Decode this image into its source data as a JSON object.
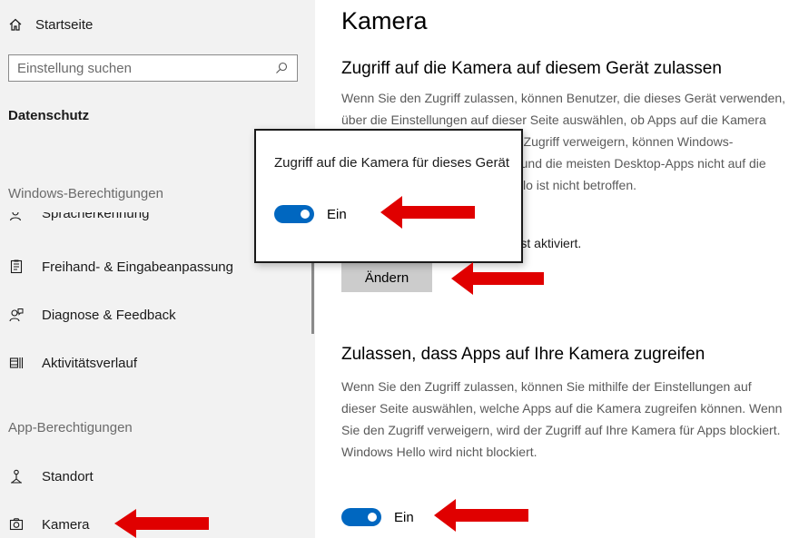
{
  "sidebar": {
    "home_label": "Startseite",
    "search_placeholder": "Einstellung suchen",
    "section_title": "Datenschutz",
    "group_windows": "Windows-Berechtigungen",
    "group_app": "App-Berechtigungen",
    "items": [
      {
        "label": "Spracherkennung",
        "icon": "speech-icon"
      },
      {
        "label": "Freihand- & Eingabeanpassung",
        "icon": "inking-typing-icon"
      },
      {
        "label": "Diagnose & Feedback",
        "icon": "feedback-icon"
      },
      {
        "label": "Aktivitätsverlauf",
        "icon": "activity-history-icon"
      },
      {
        "label": "Standort",
        "icon": "location-icon"
      },
      {
        "label": "Kamera",
        "icon": "camera-icon"
      }
    ]
  },
  "main": {
    "title": "Kamera",
    "device_access": {
      "heading": "Zugriff auf die Kamera auf diesem Gerät zulassen",
      "description": "Wenn Sie den Zugriff zulassen, können Benutzer, die dieses Gerät verwenden, über die Einstellungen auf dieser Seite auswählen, ob Apps auf die Kamera zugreifen dürfen. Wenn Sie den Zugriff verweigern, können Windows-Features, Microsoft Store-Apps und die meisten Desktop-Apps nicht auf die Kamera zugreifen. Windows Hello ist nicht betroffen.",
      "status": "Kamerazugriff für dieses Gerät ist aktiviert.",
      "change_button": "Ändern"
    },
    "app_access": {
      "heading": "Zulassen, dass Apps auf Ihre Kamera zugreifen",
      "description": "Wenn Sie den Zugriff zulassen, können Sie mithilfe der Einstellungen auf dieser Seite auswählen, welche Apps auf die Kamera zugreifen können. Wenn Sie den Zugriff verweigern, wird der Zugriff auf Ihre Kamera für Apps blockiert. Windows Hello wird nicht blockiert.",
      "toggle_label": "Ein",
      "toggle_on": true
    }
  },
  "popup": {
    "title": "Zugriff auf die Kamera für dieses Gerät",
    "toggle_label": "Ein",
    "toggle_on": true
  },
  "colors": {
    "toggle_on": "#0067c0",
    "arrow": "#e00000",
    "sidebar_bg": "#f2f2f2",
    "button_bg": "#cccccc"
  }
}
